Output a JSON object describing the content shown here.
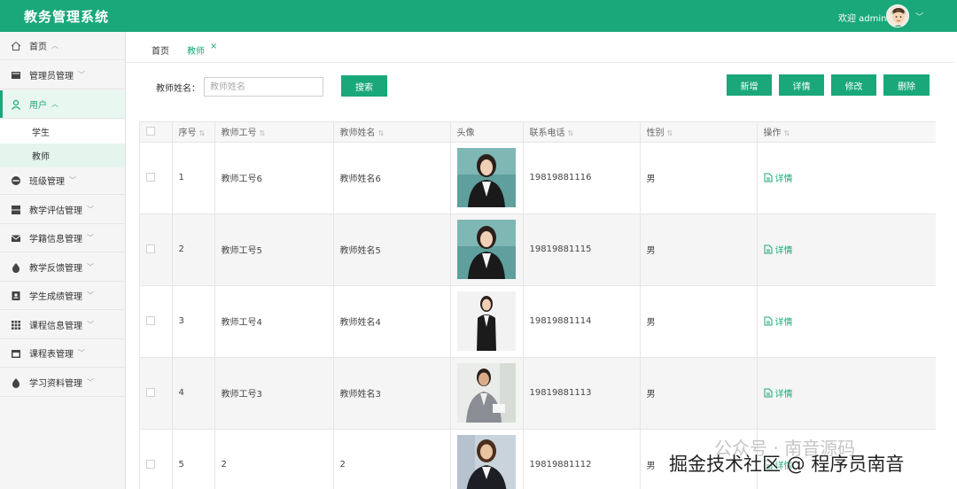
{
  "app": {
    "title": "教务管理系统",
    "welcome": "欢迎 admin",
    "accent": "#1aa87a"
  },
  "sidebar": {
    "items": [
      {
        "label": "首页",
        "icon": "home-icon"
      },
      {
        "label": "管理员管理",
        "icon": "admin-card-icon"
      },
      {
        "label": "用户",
        "icon": "user-icon"
      },
      {
        "label": "班级管理",
        "icon": "class-icon"
      },
      {
        "label": "教学评估管理",
        "icon": "server-icon"
      },
      {
        "label": "学籍信息管理",
        "icon": "mail-icon"
      },
      {
        "label": "教学反馈管理",
        "icon": "drop-icon"
      },
      {
        "label": "学生成绩管理",
        "icon": "id-card-icon"
      },
      {
        "label": "课程信息管理",
        "icon": "grid-icon"
      },
      {
        "label": "课程表管理",
        "icon": "schedule-icon"
      },
      {
        "label": "学习资料管理",
        "icon": "drop-icon"
      }
    ],
    "subitems": [
      {
        "label": "学生"
      },
      {
        "label": "教师"
      }
    ]
  },
  "tabs": [
    {
      "label": "首页"
    },
    {
      "label": "教师",
      "close": "×"
    }
  ],
  "search": {
    "label": "教师姓名：",
    "placeholder": "教师姓名",
    "button": "搜索"
  },
  "actions": {
    "add": "新增",
    "detail": "详情",
    "edit": "修改",
    "delete": "删除"
  },
  "table": {
    "columns": [
      "序号",
      "教师工号",
      "教师姓名",
      "头像",
      "联系电话",
      "性别",
      "操作"
    ],
    "op_label": "详情",
    "rows": [
      {
        "index": "1",
        "job_no": "教师工号6",
        "name": "教师姓名6",
        "phone": "19819881116",
        "gender": "男"
      },
      {
        "index": "2",
        "job_no": "教师工号5",
        "name": "教师姓名5",
        "phone": "19819881115",
        "gender": "男"
      },
      {
        "index": "3",
        "job_no": "教师工号4",
        "name": "教师姓名4",
        "phone": "19819881114",
        "gender": "男"
      },
      {
        "index": "4",
        "job_no": "教师工号3",
        "name": "教师姓名3",
        "phone": "19819881113",
        "gender": "男"
      },
      {
        "index": "5",
        "job_no": "2",
        "name": "2",
        "phone": "19819881112",
        "gender": "男"
      }
    ]
  },
  "watermark": {
    "line1": "掘金技术社区 @ 程序员南音",
    "line2": "公众号 · 南音源码"
  }
}
